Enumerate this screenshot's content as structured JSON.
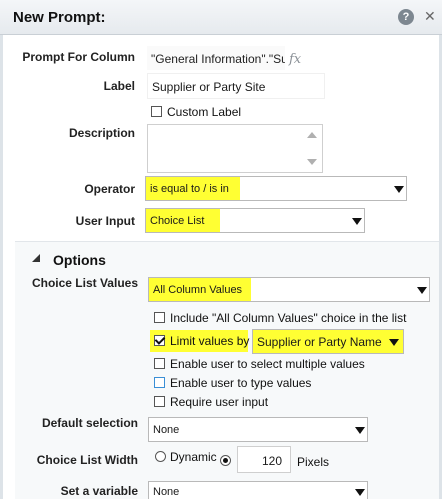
{
  "dialog": {
    "title": "New Prompt:",
    "help_icon": "?",
    "close_icon": "✕"
  },
  "form": {
    "prompt_for_column": {
      "label": "Prompt For Column",
      "value": "\"General Information\".\"Su",
      "fx": "fx"
    },
    "label": {
      "label": "Label",
      "value": "Supplier or Party Site"
    },
    "custom_label": {
      "label": "Custom Label",
      "checked": false
    },
    "description": {
      "label": "Description",
      "value": ""
    },
    "operator": {
      "label": "Operator",
      "value": "is equal to / is in"
    },
    "user_input": {
      "label": "User Input",
      "value": "Choice List"
    }
  },
  "options": {
    "title": "Options",
    "choice_list_values": {
      "label": "Choice List Values",
      "value": "All Column Values"
    },
    "include_all_column_values": {
      "label": "Include \"All Column Values\" choice in the list",
      "checked": false
    },
    "limit_values_by": {
      "label": "Limit values by",
      "checked": true,
      "value": "Supplier or Party Name"
    },
    "enable_multiple": {
      "label": "Enable user to select multiple values",
      "checked": false
    },
    "enable_type": {
      "label": "Enable user to type values",
      "checked": false
    },
    "require_input": {
      "label": "Require user input",
      "checked": false
    },
    "default_selection": {
      "label": "Default selection",
      "value": "None"
    },
    "choice_list_width": {
      "label": "Choice List Width",
      "dynamic_label": "Dynamic",
      "width_value": "120",
      "unit": "Pixels",
      "mode": "fixed"
    },
    "set_variable": {
      "label": "Set a variable",
      "value": "None"
    }
  },
  "colors": {
    "highlight": "#ffff33",
    "title_bar": "#e9edf0",
    "focus_blue": "#3a8fd6"
  }
}
